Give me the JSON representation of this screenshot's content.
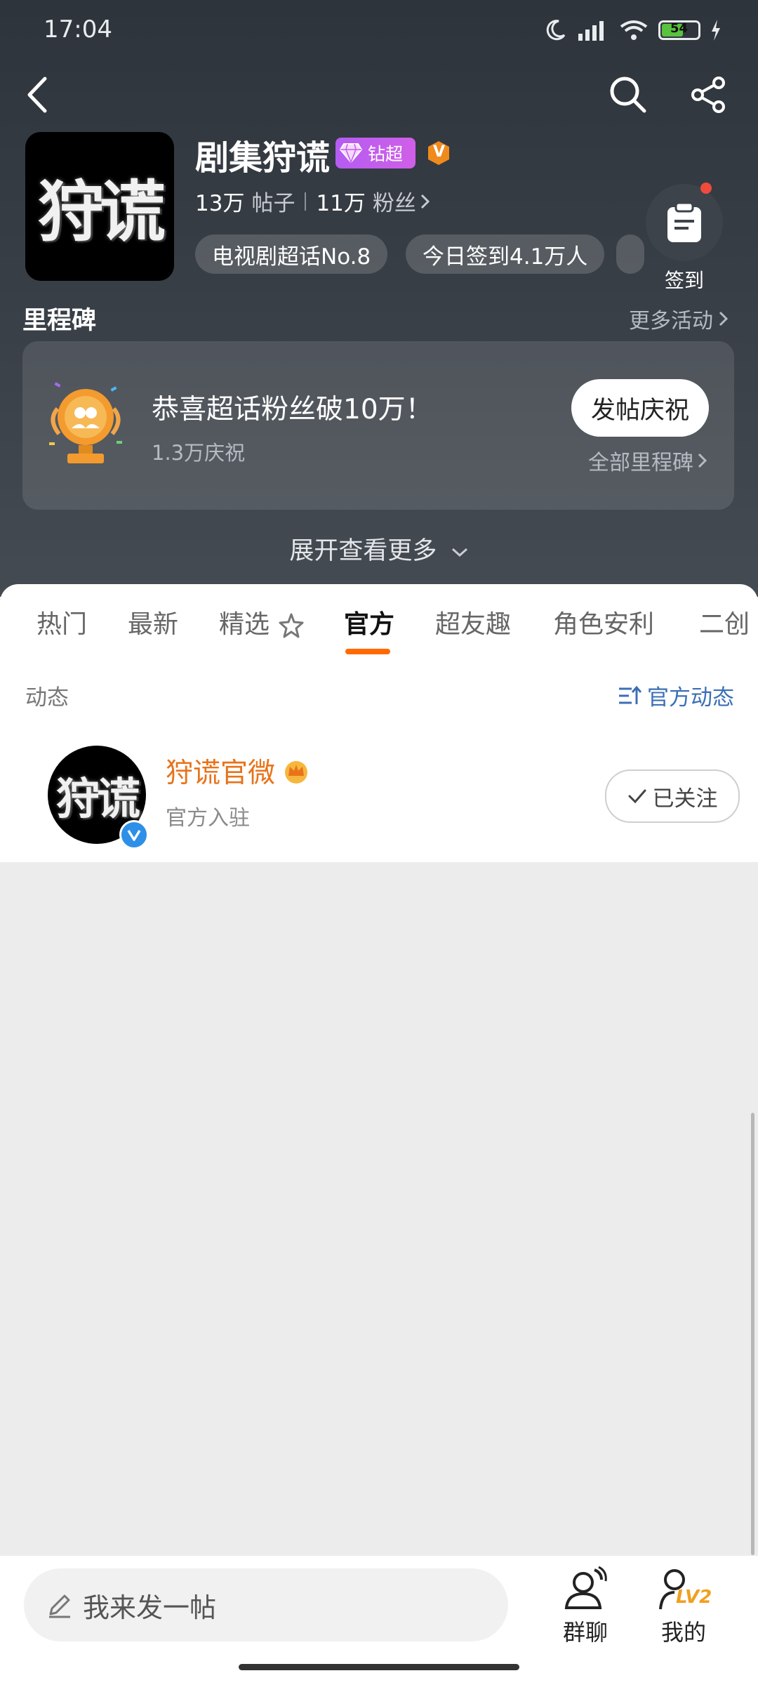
{
  "status_bar": {
    "time": "17:04",
    "battery": "54"
  },
  "topic": {
    "name": "剧集狩谎",
    "cover_text": "狩谎",
    "badge_label": "钻超",
    "badge_v": "V",
    "posts_count": "13万",
    "posts_label": "帖子",
    "fans_count": "11万",
    "fans_label": "粉丝",
    "chips": [
      "电视剧超话No.8",
      "今日签到4.1万人"
    ],
    "checkin_label": "签到"
  },
  "milestone": {
    "section_title": "里程碑",
    "more_link": "更多活动",
    "title": "恭喜超话粉丝破10万！",
    "subtitle": "1.3万庆祝",
    "button": "发帖庆祝",
    "all_link": "全部里程碑"
  },
  "expand_label": "展开查看更多",
  "tabs": [
    "热门",
    "最新",
    "精选",
    "官方",
    "超友趣",
    "角色安利",
    "二创"
  ],
  "active_tab": "官方",
  "feed": {
    "label": "动态",
    "right_link": "官方动态",
    "user": {
      "avatar_text": "狩谎",
      "name": "狩谎官微",
      "subtitle": "官方入驻",
      "follow_label": "已关注"
    }
  },
  "bottom": {
    "post_placeholder": "我来发一帖",
    "group_chat": "群聊",
    "mine": "我的",
    "level_badge": "LV2"
  },
  "colors": {
    "accent": "#ff6a00",
    "name_orange": "#e8731a",
    "link_blue": "#3c6fb5"
  }
}
